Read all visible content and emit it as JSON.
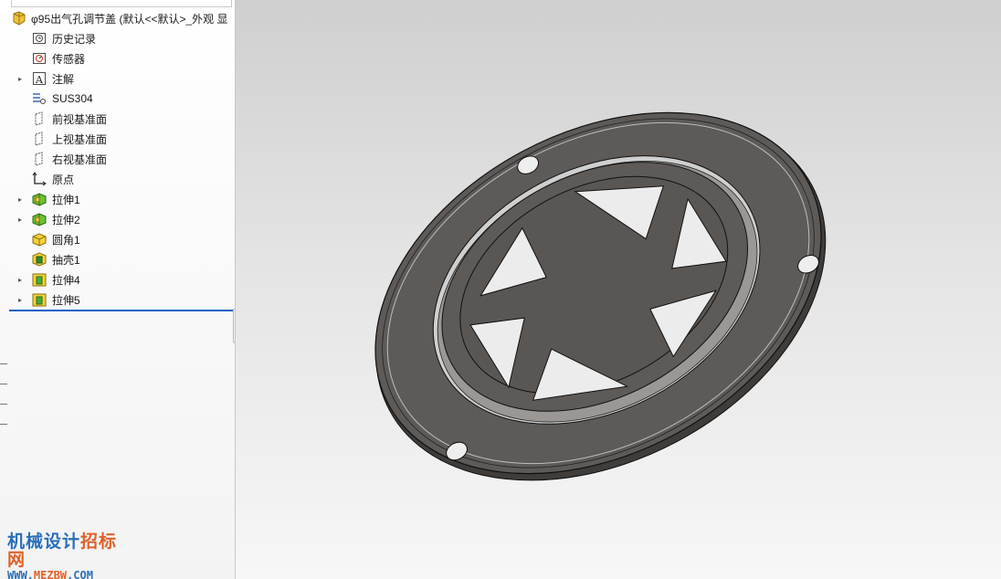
{
  "feature_tree": {
    "root": {
      "label": "φ95出气孔调节盖 (默认<<默认>_外观 显",
      "icon": "part-icon"
    },
    "items": [
      {
        "label": "历史记录",
        "icon": "history-folder-icon",
        "expandable": false
      },
      {
        "label": "传感器",
        "icon": "sensor-icon",
        "expandable": false
      },
      {
        "label": "注解",
        "icon": "annotation-icon",
        "expandable": true
      },
      {
        "label": "SUS304",
        "icon": "material-icon",
        "expandable": false
      },
      {
        "label": "前视基准面",
        "icon": "plane-icon",
        "expandable": false
      },
      {
        "label": "上视基准面",
        "icon": "plane-icon",
        "expandable": false
      },
      {
        "label": "右视基准面",
        "icon": "plane-icon",
        "expandable": false
      },
      {
        "label": "原点",
        "icon": "origin-icon",
        "expandable": false
      },
      {
        "label": "拉伸1",
        "icon": "extrude-icon",
        "expandable": true
      },
      {
        "label": "拉伸2",
        "icon": "extrude-icon",
        "expandable": true
      },
      {
        "label": "圆角1",
        "icon": "fillet-icon",
        "expandable": false
      },
      {
        "label": "抽壳1",
        "icon": "shell-icon",
        "expandable": false
      },
      {
        "label": "拉伸4",
        "icon": "extrude-cut-icon",
        "expandable": true
      },
      {
        "label": "拉伸5",
        "icon": "extrude-cut-icon",
        "expandable": true
      }
    ]
  },
  "watermark": {
    "line1_a": "机械设计",
    "line1_b": "招标网",
    "line2_a": "WWW.",
    "line2_b": "MEZBW",
    "line2_c": ".COM"
  },
  "colors": {
    "rollback_bar": "#1c5fc8",
    "part_face": "#5e5a58",
    "part_edge": "#1a1a1a",
    "watermark_blue": "#2a6fb8",
    "watermark_orange": "#e0622a"
  }
}
